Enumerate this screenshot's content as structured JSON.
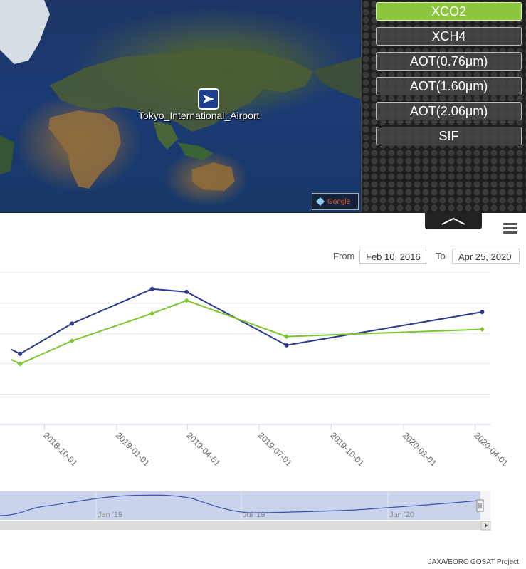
{
  "map": {
    "airport_label": "Tokyo_International_Airport",
    "airport_icon": "airplane-icon",
    "attribution": "Google"
  },
  "panel": {
    "buttons": [
      {
        "label": "XCO2",
        "active": true
      },
      {
        "label": "XCH4",
        "active": false
      },
      {
        "label": "AOT(0.76μm)",
        "active": false
      },
      {
        "label": "AOT(1.60μm)",
        "active": false
      },
      {
        "label": "AOT(2.06μm)",
        "active": false
      },
      {
        "label": "SIF",
        "active": false
      }
    ],
    "active_color": "#8cc63e"
  },
  "range": {
    "from_label": "From",
    "from_value": "Feb 10, 2016",
    "to_label": "To",
    "to_value": "Apr 25, 2020"
  },
  "chart_data": {
    "type": "line",
    "x_ticks": [
      "2018-10-01",
      "2019-01-01",
      "2019-04-01",
      "2019-07-01",
      "2019-10-01",
      "2020-01-01",
      "2020-04-01"
    ],
    "x_tick_dates": [
      "2018-10-01",
      "2019-01-01",
      "2019-04-01",
      "2019-07-01",
      "2019-10-01",
      "2020-01-01",
      "2020-04-01"
    ],
    "grid": true,
    "series": [
      {
        "color": "#2b3a8c",
        "points": [
          {
            "x": "2018-08-20",
            "y": 0.52
          },
          {
            "x": "2018-08-31",
            "y": 0.49
          },
          {
            "x": "2018-11-05",
            "y": 0.7
          },
          {
            "x": "2019-02-15",
            "y": 0.94
          },
          {
            "x": "2019-03-31",
            "y": 0.92
          },
          {
            "x": "2019-08-05",
            "y": 0.55
          },
          {
            "x": "2020-04-10",
            "y": 0.78
          }
        ]
      },
      {
        "color": "#7cc72c",
        "points": [
          {
            "x": "2018-08-20",
            "y": 0.45
          },
          {
            "x": "2018-08-31",
            "y": 0.42
          },
          {
            "x": "2018-11-05",
            "y": 0.58
          },
          {
            "x": "2019-02-15",
            "y": 0.77
          },
          {
            "x": "2019-03-31",
            "y": 0.86
          },
          {
            "x": "2019-08-05",
            "y": 0.61
          },
          {
            "x": "2020-04-10",
            "y": 0.66
          }
        ]
      }
    ]
  },
  "navigator": {
    "labels": [
      "Jan '19",
      "Jul '19",
      "Jan '20"
    ]
  },
  "footer": {
    "credit": "JAXA/EORC GOSAT Project"
  }
}
